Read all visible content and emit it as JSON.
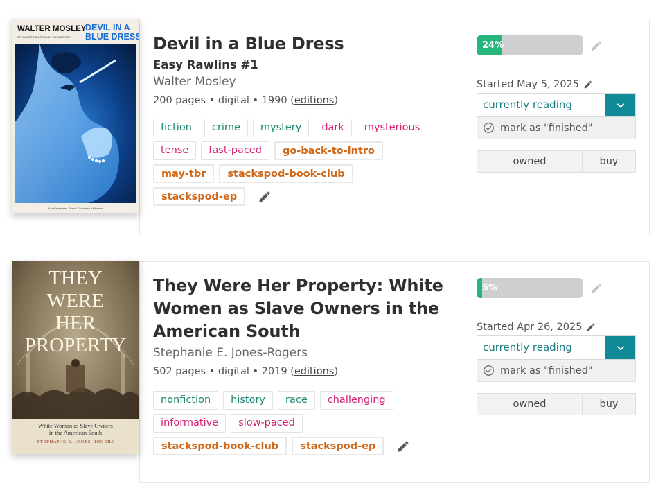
{
  "books": [
    {
      "title": "Devil in a Blue Dress",
      "series": "Easy Rawlins #1",
      "author": "Walter Mosley",
      "meta_prefix": "200 pages • digital • 1990 (",
      "editions_link": "editions",
      "meta_suffix": ")",
      "cover": {
        "author_text": "WALTER MOSLEY",
        "intro_text": "WITH AN INTRODUCTION BY VAL McDERMID",
        "title_line1": "DEVIL IN A",
        "title_line2": "BLUE DRESS",
        "blurb": "'A brilliant novel. Period.' Jonathan Kellerman"
      },
      "tags": [
        {
          "label": "fiction",
          "kind": "green"
        },
        {
          "label": "crime",
          "kind": "green"
        },
        {
          "label": "mystery",
          "kind": "green"
        },
        {
          "label": "dark",
          "kind": "pink"
        },
        {
          "label": "mysterious",
          "kind": "pink"
        },
        {
          "label": "tense",
          "kind": "pink"
        },
        {
          "label": "fast-paced",
          "kind": "pink"
        },
        {
          "label": "go-back-to-intro",
          "kind": "orange"
        },
        {
          "label": "may-tbr",
          "kind": "orange"
        },
        {
          "label": "stackspod-book-club",
          "kind": "orange"
        },
        {
          "label": "stackspod-ep",
          "kind": "orange"
        }
      ],
      "progress_label": "24%",
      "progress_value": 0.24,
      "started": "Started May 5, 2025",
      "status": "currently reading",
      "mark_finished": "mark as \"finished\"",
      "owned_label": "owned",
      "buy_label": "buy"
    },
    {
      "title": "They Were Her Property: White Women as Slave Owners in the American South",
      "series": "",
      "author": "Stephanie E. Jones-Rogers",
      "meta_prefix": "502 pages • digital • 2019 (",
      "editions_link": "editions",
      "meta_suffix": ")",
      "cover": {
        "title_lines": [
          "THEY",
          "WERE",
          "HER",
          "PROPERTY"
        ],
        "subtitle1": "White Women as Slave Owners",
        "subtitle2": "in the American South",
        "author_text": "STEPHANIE E. JONES-ROGERS"
      },
      "tags": [
        {
          "label": "nonfiction",
          "kind": "green"
        },
        {
          "label": "history",
          "kind": "green"
        },
        {
          "label": "race",
          "kind": "green"
        },
        {
          "label": "challenging",
          "kind": "pink"
        },
        {
          "label": "informative",
          "kind": "pink"
        },
        {
          "label": "slow-paced",
          "kind": "pink"
        },
        {
          "label": "stackspod-book-club",
          "kind": "orange"
        },
        {
          "label": "stackspod-ep",
          "kind": "orange"
        }
      ],
      "progress_label": "5%",
      "progress_value": 0.05,
      "started": "Started Apr 26, 2025",
      "status": "currently reading",
      "mark_finished": "mark as \"finished\"",
      "owned_label": "owned",
      "buy_label": "buy"
    }
  ],
  "colors": {
    "green_tag": "#1e8872",
    "pink_tag": "#d41f72",
    "orange_tag": "#d06818",
    "progress_fill": "#26b57b",
    "status_button": "#0f8a96",
    "status_text": "#177d82"
  },
  "icons": {
    "tag_edit": "pencil-icon",
    "progress_edit": "pencil-icon",
    "started_edit": "pencil-icon",
    "status_dropdown": "chevron-down-icon",
    "finish": "check-circle-icon"
  }
}
